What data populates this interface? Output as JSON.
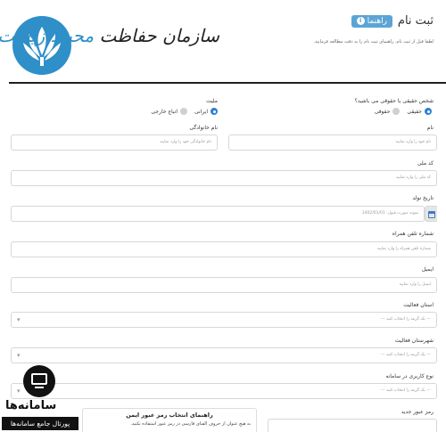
{
  "header": {
    "logo_text_main": "سازمان حفاظت",
    "logo_text_accent": "محیط زیست",
    "page_title": "ثبت نام",
    "help_label": "راهنما",
    "intro": "لطفا قبل از ثبت نام، راهنمای ثبت نام را به دقت مطالعه فرمایید."
  },
  "form": {
    "person_type": {
      "label": "شخص حقیقی یا حقوقی می باشید؟",
      "options": [
        "حقیقی",
        "حقوقی"
      ],
      "selected": "حقیقی"
    },
    "nationality": {
      "label": "ملیت",
      "options": [
        "ایرانی",
        "اتباع خارجی"
      ],
      "selected": "ایرانی"
    },
    "first_name": {
      "label": "نام",
      "placeholder": "نام خود را وارد نمایید"
    },
    "last_name": {
      "label": "نام خانوادگی",
      "placeholder": "نام خانوادگی خود را وارد نمایید"
    },
    "national_code": {
      "label": "کد ملی",
      "placeholder": "کد ملی را وارد نمایید"
    },
    "birth_date": {
      "label": "تاریخ تولد",
      "placeholder": "نمونه صورت قبول: 1402/01/01"
    },
    "mobile": {
      "label": "شماره تلفن همراه",
      "placeholder": "شماره تلفن همراه را وارد نمایید"
    },
    "email": {
      "label": "ایمیل",
      "placeholder": "ایمیل را وارد نمایید"
    },
    "province": {
      "label": "استان فعالیت",
      "placeholder": "--- یک گزینه را انتخاب کنید ---"
    },
    "city": {
      "label": "شهرستان فعالیت",
      "placeholder": "--- یک گزینه را انتخاب کنید ---"
    },
    "user_type": {
      "label": "نوع کاربری در سامانه",
      "placeholder": "--- یک گزینه را انتخاب کنید ---"
    },
    "new_password": {
      "label": "رمز عبور جدید"
    }
  },
  "guide": {
    "title": "راهنمای انتخاب رمز عبور ایمن",
    "text": "به هیچ عنوان از حروف الفبای فارسی در رمز عبور استفاده نکنید."
  },
  "watermark": {
    "title": "سامانه‌ها",
    "subtitle": "پورتال جامع سامانه‌ها"
  }
}
